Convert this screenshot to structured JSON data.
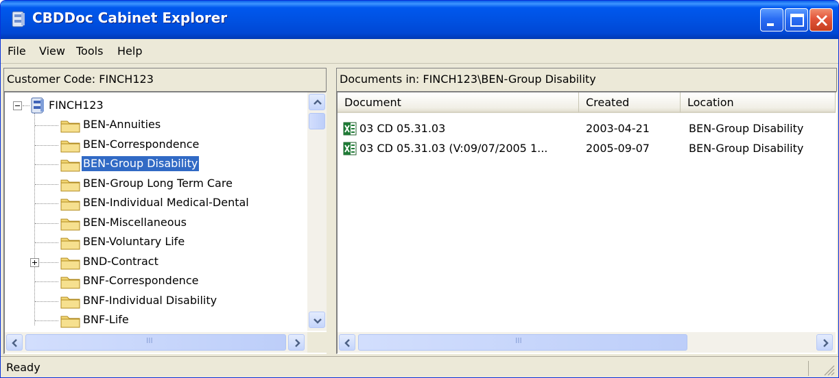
{
  "window": {
    "title": "CBDDoc Cabinet Explorer"
  },
  "menu": {
    "items": [
      "File",
      "View",
      "Tools",
      "Help"
    ]
  },
  "left_pane": {
    "header": "Customer Code: FINCH123",
    "root_label": "FINCH123",
    "folders": [
      {
        "label": "BEN-Annuities",
        "selected": false,
        "expandable": false
      },
      {
        "label": "BEN-Correspondence",
        "selected": false,
        "expandable": false
      },
      {
        "label": "BEN-Group Disability",
        "selected": true,
        "expandable": false
      },
      {
        "label": "BEN-Group Long Term Care",
        "selected": false,
        "expandable": false
      },
      {
        "label": "BEN-Individual Medical-Dental",
        "selected": false,
        "expandable": false
      },
      {
        "label": "BEN-Miscellaneous",
        "selected": false,
        "expandable": false
      },
      {
        "label": "BEN-Voluntary Life",
        "selected": false,
        "expandable": false
      },
      {
        "label": "BND-Contract",
        "selected": false,
        "expandable": true
      },
      {
        "label": "BNF-Correspondence",
        "selected": false,
        "expandable": false
      },
      {
        "label": "BNF-Individual Disability",
        "selected": false,
        "expandable": false
      },
      {
        "label": "BNF-Life",
        "selected": false,
        "expandable": false
      }
    ],
    "scrollbar_grip": "III"
  },
  "right_pane": {
    "header": "Documents in: FINCH123\\BEN-Group Disability",
    "columns": [
      "Document",
      "Created",
      "Location"
    ],
    "rows": [
      {
        "document": "03 CD 05.31.03",
        "created": "2003-04-21",
        "location": "BEN-Group Disability",
        "icon": "excel-file-icon"
      },
      {
        "document": "03 CD 05.31.03 (V:09/07/2005 1...",
        "created": "2005-09-07",
        "location": "BEN-Group Disability",
        "icon": "excel-file-icon"
      }
    ],
    "scrollbar_grip": "III"
  },
  "status": {
    "text": "Ready"
  },
  "colors": {
    "titlebar": "#0050e0",
    "selection": "#316ac5",
    "chrome": "#ece9d8"
  }
}
